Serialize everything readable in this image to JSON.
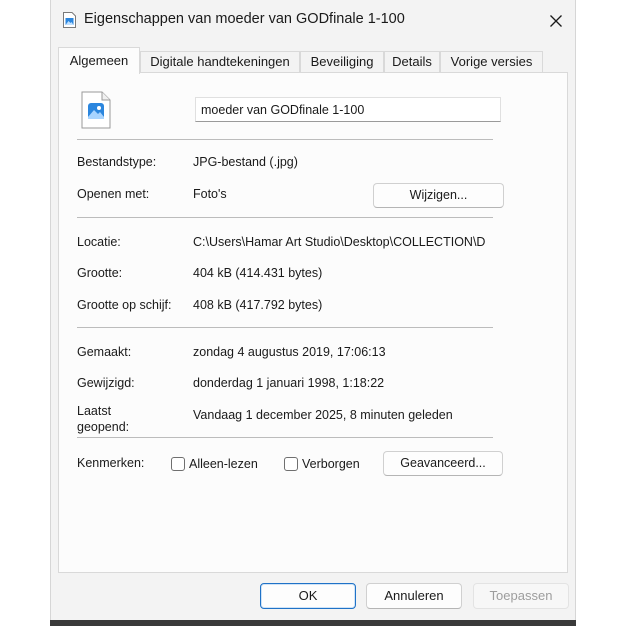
{
  "window": {
    "title": "Eigenschappen van moeder van GODfinale 1-100"
  },
  "tabs": [
    {
      "label": "Algemeen",
      "active": true
    },
    {
      "label": "Digitale handtekeningen",
      "active": false
    },
    {
      "label": "Beveiliging",
      "active": false
    },
    {
      "label": "Details",
      "active": false
    },
    {
      "label": "Vorige versies",
      "active": false
    }
  ],
  "general": {
    "filename": "moeder van GODfinale 1-100",
    "file_type_label": "Bestandstype:",
    "file_type_value": "JPG-bestand (.jpg)",
    "opens_with_label": "Openen met:",
    "opens_with_value": "Foto's",
    "change_button": "Wijzigen...",
    "location_label": "Locatie:",
    "location_value": "C:\\Users\\Hamar Art Studio\\Desktop\\COLLECTION\\D",
    "size_label": "Grootte:",
    "size_value": "404 kB (414.431 bytes)",
    "size_on_disk_label": "Grootte op schijf:",
    "size_on_disk_value": "408 kB (417.792 bytes)",
    "created_label": "Gemaakt:",
    "created_value": "zondag 4 augustus 2019, 17:06:13",
    "modified_label": "Gewijzigd:",
    "modified_value": "donderdag 1 januari 1998, 1:18:22",
    "accessed_label_line1": "Laatst",
    "accessed_label_line2": "geopend:",
    "accessed_value": "Vandaag 1 december 2025, 8 minuten geleden",
    "attributes_label": "Kenmerken:",
    "readonly_label": "Alleen-lezen",
    "hidden_label": "Verborgen",
    "advanced_button": "Geavanceerd..."
  },
  "footer": {
    "ok_label": "OK",
    "cancel_label": "Annuleren",
    "apply_label": "Toepassen"
  },
  "colors": {
    "accent": "#1f72c7",
    "icon_blue": "#2b86de"
  },
  "icons": {
    "title": "image-file-icon",
    "close": "close-icon",
    "file": "image-file-icon"
  }
}
